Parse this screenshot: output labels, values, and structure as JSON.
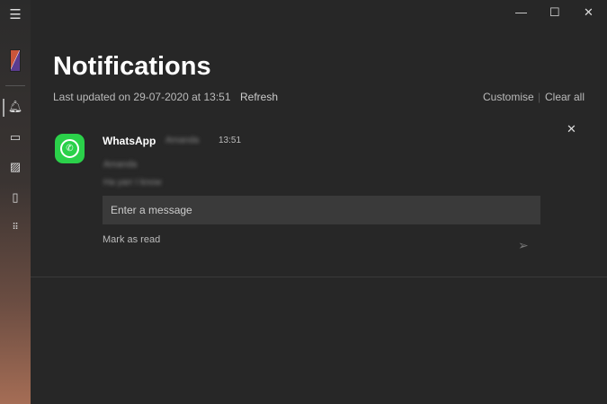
{
  "sidebar": {
    "items": [
      "menu-icon",
      "phone-thumbnail",
      "notifications-icon",
      "messages-icon",
      "photos-icon",
      "phone-screen-icon",
      "apps-icon"
    ]
  },
  "window": {
    "minimize": "—",
    "maximize": "☐",
    "close": "✕"
  },
  "page": {
    "title": "Notifications",
    "last_updated": "Last updated on 29-07-2020 at 13:51",
    "refresh": "Refresh",
    "customise": "Customise",
    "clear_all": "Clear all"
  },
  "notification": {
    "app": "WhatsApp",
    "sender": "Amanda",
    "time": "13:51",
    "title": "Amanda",
    "message": "Ha yarr I know",
    "input_placeholder": "Enter a message",
    "mark_read": "Mark as read",
    "dismiss": "✕",
    "send": "➢"
  },
  "colors": {
    "whatsapp": "#2bd14a",
    "background": "#272727"
  }
}
